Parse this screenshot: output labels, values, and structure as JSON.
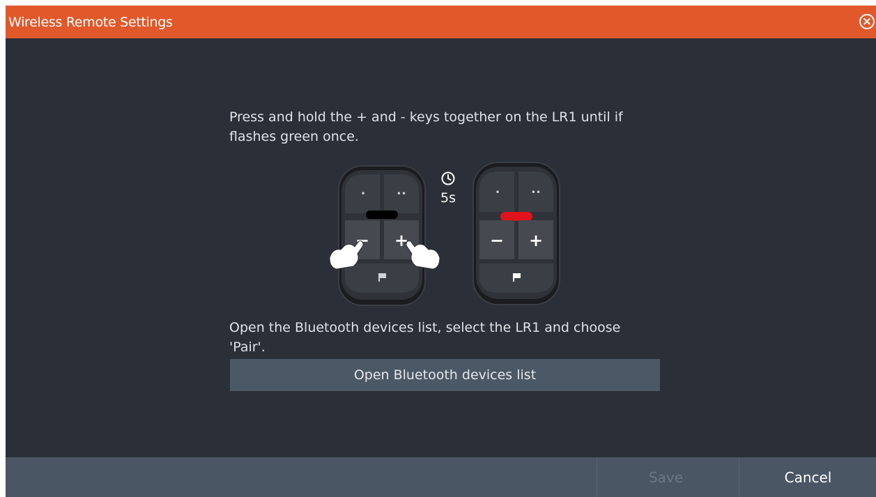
{
  "dialog": {
    "title": "Wireless Remote Settings",
    "close_icon": "close-circle-icon"
  },
  "instructions": {
    "step1": "Press and hold the + and - keys together on the LR1 until if flashes green once.",
    "step2": "Open the Bluetooth devices list, select the LR1 and choose 'Pair'."
  },
  "illustration": {
    "timer_icon": "clock-icon",
    "timer_value": "5s",
    "remote_left": {
      "dot_keys": [
        "•",
        "••"
      ],
      "minus": "−",
      "plus": "+",
      "flag_icon": "flag-icon",
      "led_color": "#000000",
      "hand_icon": "hand-press-icon"
    },
    "remote_right": {
      "dot_keys": [
        "•",
        "••"
      ],
      "minus": "−",
      "plus": "+",
      "flag_icon": "flag-icon",
      "led_color": "#e0121b"
    }
  },
  "actions": {
    "open_bt_list": "Open Bluetooth devices list"
  },
  "footer": {
    "save": "Save",
    "cancel": "Cancel"
  },
  "colors": {
    "accent": "#e1582a",
    "background": "#2b2f37",
    "footer": "#4a5663",
    "button": "#4b5865"
  }
}
